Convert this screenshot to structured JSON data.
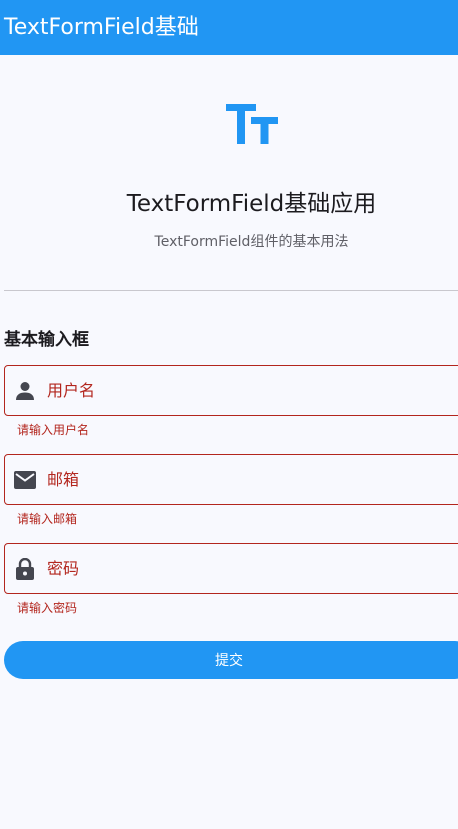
{
  "app_bar": {
    "title": "TextFormField基础"
  },
  "header": {
    "logo_icon": "text-fields-icon",
    "title": "TextFormField基础应用",
    "subtitle": "TextFormField组件的基本用法"
  },
  "section": {
    "title": "基本输入框"
  },
  "fields": [
    {
      "icon": "person-icon",
      "label": "用户名",
      "value": "",
      "error": "请输入用户名"
    },
    {
      "icon": "email-icon",
      "label": "邮箱",
      "value": "",
      "error": "请输入邮箱"
    },
    {
      "icon": "lock-icon",
      "label": "密码",
      "value": "",
      "error": "请输入密码"
    }
  ],
  "submit": {
    "label": "提交"
  },
  "colors": {
    "primary": "#2196f3",
    "error": "#b3261e",
    "background": "#f8f9fe",
    "icon": "#44464f"
  }
}
